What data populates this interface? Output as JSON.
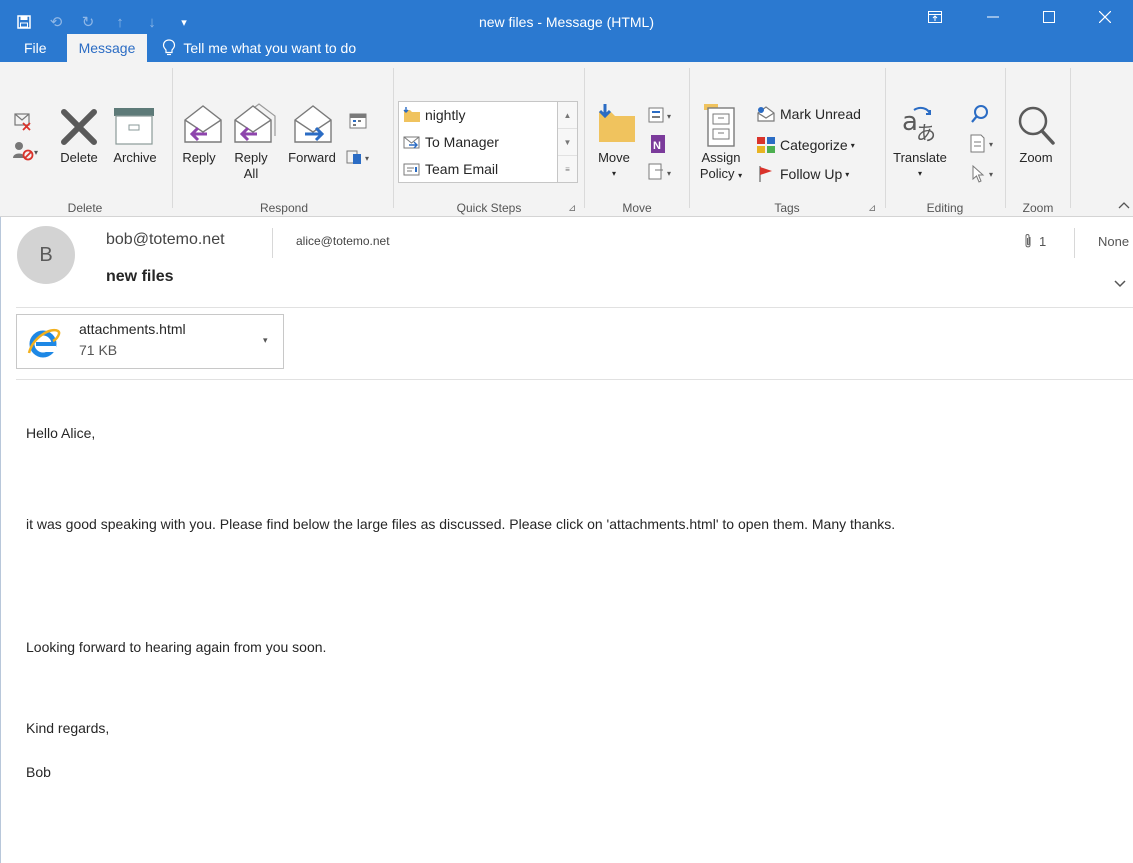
{
  "window": {
    "title": "new files  -  Message (HTML)"
  },
  "tabs": [
    {
      "label": "File"
    },
    {
      "label": "Message"
    }
  ],
  "tell_me": "Tell me what you want to do",
  "ribbon": {
    "delete_group": {
      "label": "Delete",
      "delete_label": "Delete",
      "archive_label": "Archive"
    },
    "respond_group": {
      "label": "Respond",
      "reply_label": "Reply",
      "reply_all_label_1": "Reply",
      "reply_all_label_2": "All",
      "forward_label": "Forward"
    },
    "quick_steps_group": {
      "label": "Quick Steps",
      "items": [
        {
          "label": "nightly"
        },
        {
          "label": "To Manager"
        },
        {
          "label": "Team Email"
        }
      ]
    },
    "move_group": {
      "label": "Move",
      "move_label": "Move"
    },
    "tags_group": {
      "label": "Tags",
      "assign_label_1": "Assign",
      "assign_label_2": "Policy",
      "mark_unread": "Mark Unread",
      "categorize": "Categorize",
      "follow_up": "Follow Up"
    },
    "editing_group": {
      "label": "Editing",
      "translate_label": "Translate"
    },
    "zoom_group": {
      "label": "Zoom",
      "zoom_label": "Zoom"
    }
  },
  "message": {
    "avatar_letter": "B",
    "from": "bob@totemo.net",
    "to": "alice@totemo.net",
    "subject": "new files",
    "attachment_count": "1",
    "retention": "None",
    "attachment": {
      "name": "attachments.html",
      "size": "71 KB"
    },
    "body": {
      "greeting": "Hello Alice,",
      "para1": "it was good speaking with you. Please find below the large files as discussed. Please click on 'attachments.html' to open them. Many thanks.",
      "para2": "Looking forward to hearing again from you soon.",
      "closing": "Kind regards,",
      "signature": "Bob"
    }
  },
  "colors": {
    "title_bar": "#2b79d0",
    "ribbon_bg": "#f3f3f3",
    "reply_arrow": "#8e44ad",
    "forward_arrow": "#2b6cc4",
    "follow_up_flag": "#d9332b"
  }
}
